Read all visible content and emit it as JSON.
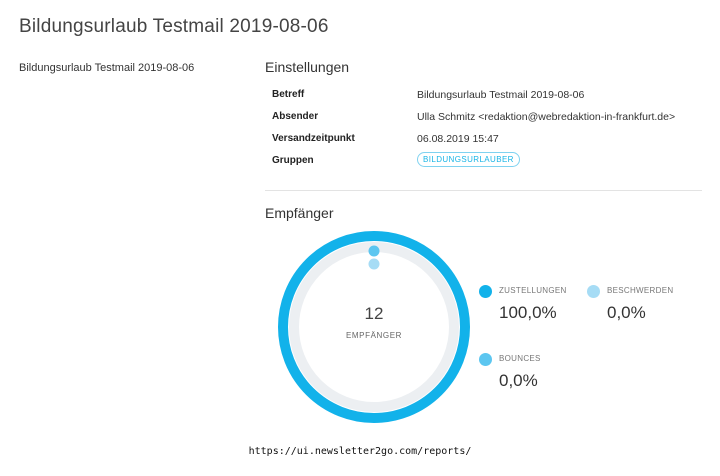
{
  "page": {
    "title": "Bildungsurlaub Testmail 2019-08-06",
    "sidebar_name": "Bildungsurlaub Testmail 2019-08-06"
  },
  "settings": {
    "heading": "Einstellungen",
    "rows": [
      {
        "label": "Betreff",
        "value": "Bildungsurlaub Testmail 2019-08-06"
      },
      {
        "label": "Absender",
        "value": "Ulla Schmitz <redaktion@webredaktion-in-frankfurt.de>"
      },
      {
        "label": "Versandzeitpunkt",
        "value": "06.08.2019 15:47"
      },
      {
        "label": "Gruppen",
        "badge": "BILDUNGSURLAUBER"
      }
    ]
  },
  "recipients": {
    "heading": "Empfänger",
    "count": "12",
    "count_label": "EMPFÄNGER",
    "stats": [
      {
        "label": "ZUSTELLUNGEN",
        "value": "100,0%",
        "color": "#12b2ea",
        "fraction": 1.0
      },
      {
        "label": "BESCHWERDEN",
        "value": "0,0%",
        "color": "#a6dcf5",
        "fraction": 0.0
      },
      {
        "label": "BOUNCES",
        "value": "0,0%",
        "color": "#5cc6f0",
        "fraction": 0.0
      }
    ],
    "track_color": "#eceff2"
  },
  "footer": {
    "url": "https://ui.newsletter2go.com/reports/"
  }
}
